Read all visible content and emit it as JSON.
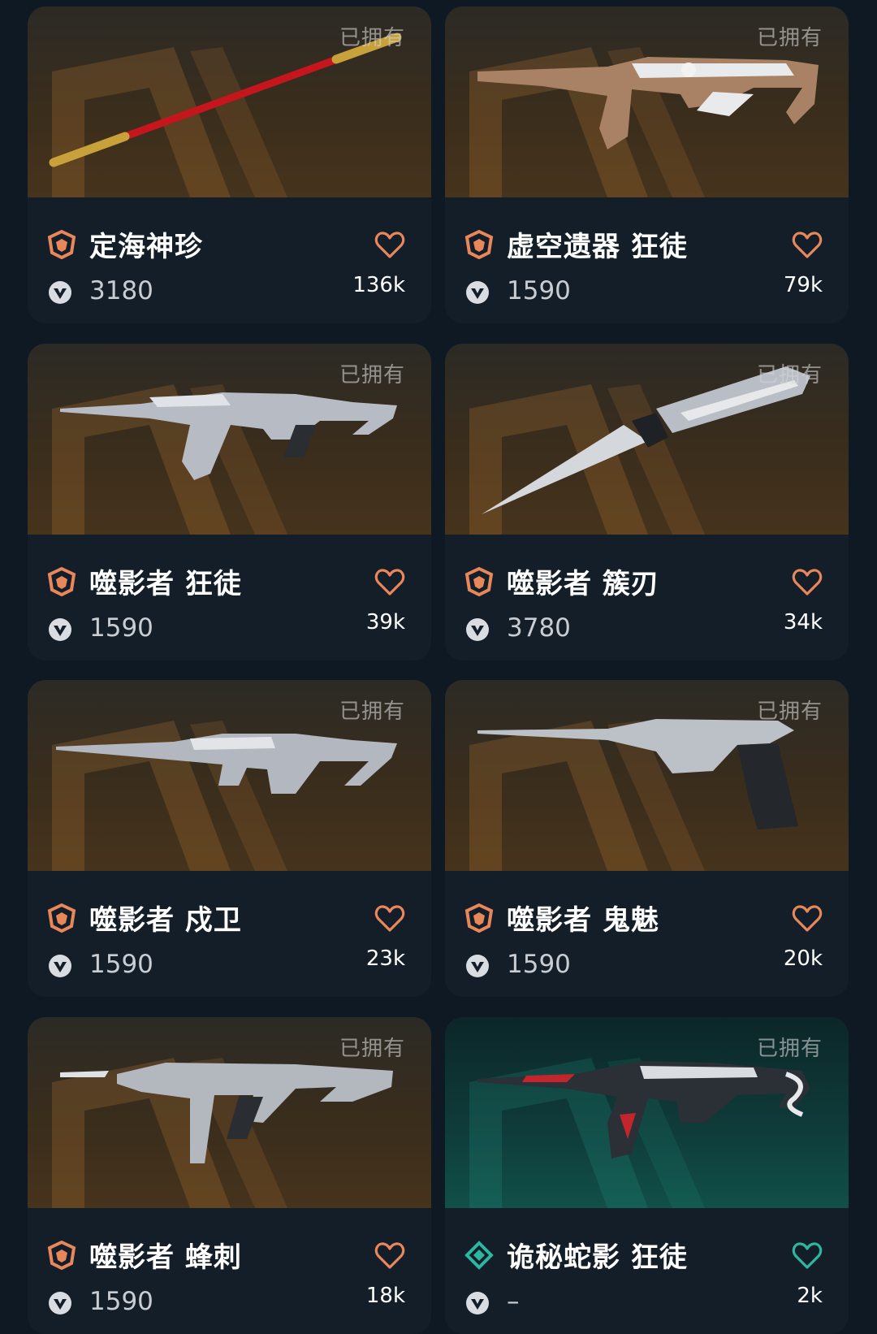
{
  "owned_label": "已拥有",
  "colors": {
    "page_bg": "#0f1923",
    "card_bg": "#131e29",
    "tier_orange": "#e8875a",
    "tier_teal": "#2cb7a1",
    "heart_orange": "#e8875a",
    "heart_teal": "#2cb7a1"
  },
  "cards": [
    {
      "name": "定海神珍",
      "price": "3180",
      "likes": "136k",
      "tier_icon": "orange-tier-icon",
      "theme": "orange",
      "weapon_icon": "staff-icon"
    },
    {
      "name": "虚空遗器 狂徒",
      "price": "1590",
      "likes": "79k",
      "tier_icon": "orange-tier-icon",
      "theme": "orange",
      "weapon_icon": "rifle-icon"
    },
    {
      "name": "噬影者 狂徒",
      "price": "1590",
      "likes": "39k",
      "tier_icon": "orange-tier-icon",
      "theme": "orange",
      "weapon_icon": "rifle-icon"
    },
    {
      "name": "噬影者 簇刃",
      "price": "3780",
      "likes": "34k",
      "tier_icon": "orange-tier-icon",
      "theme": "orange",
      "weapon_icon": "knife-icon"
    },
    {
      "name": "噬影者 戍卫",
      "price": "1590",
      "likes": "23k",
      "tier_icon": "orange-tier-icon",
      "theme": "orange",
      "weapon_icon": "rifle-icon"
    },
    {
      "name": "噬影者 鬼魅",
      "price": "1590",
      "likes": "20k",
      "tier_icon": "orange-tier-icon",
      "theme": "orange",
      "weapon_icon": "pistol-icon"
    },
    {
      "name": "噬影者 蜂刺",
      "price": "1590",
      "likes": "18k",
      "tier_icon": "orange-tier-icon",
      "theme": "orange",
      "weapon_icon": "smg-icon"
    },
    {
      "name": "诡秘蛇影 狂徒",
      "price": "–",
      "likes": "2k",
      "tier_icon": "teal-tier-icon",
      "theme": "teal",
      "weapon_icon": "rifle-icon"
    }
  ]
}
